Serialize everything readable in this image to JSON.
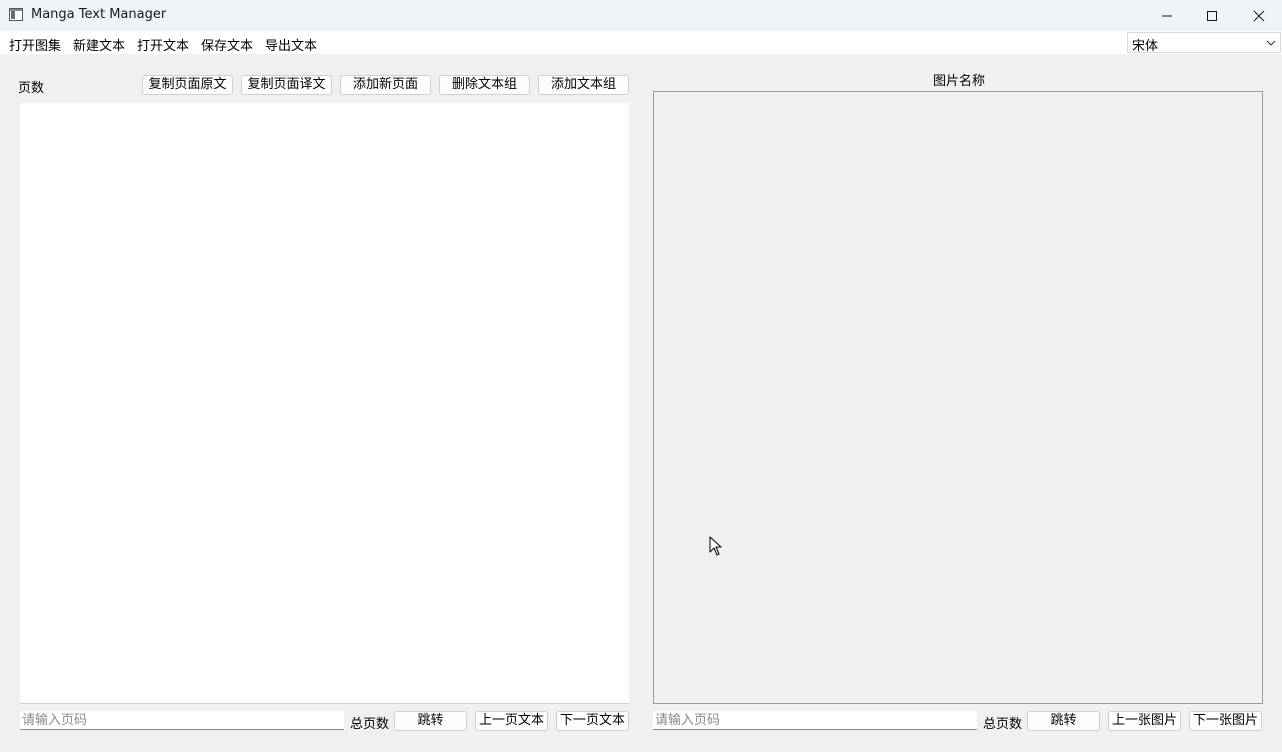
{
  "window": {
    "title": "Manga Text Manager"
  },
  "menu": {
    "items": [
      "打开图集",
      "新建文本",
      "打开文本",
      "保存文本",
      "导出文本"
    ],
    "font_select_value": "宋体"
  },
  "left_panel": {
    "page_label": "页数",
    "buttons": {
      "copy_original": "复制页面原文",
      "copy_translation": "复制页面译文",
      "add_page": "添加新页面",
      "delete_group": "删除文本组",
      "add_group": "添加文本组"
    },
    "page_input_placeholder": "请输入页码",
    "total_pages_label": "总页数",
    "jump_button": "跳转",
    "prev_button": "上一页文本",
    "next_button": "下一页文本"
  },
  "right_panel": {
    "image_name_label": "图片名称",
    "page_input_placeholder": "请输入页码",
    "total_pages_label": "总页数",
    "jump_button": "跳转",
    "prev_button": "上一张图片",
    "next_button": "下一张图片"
  }
}
